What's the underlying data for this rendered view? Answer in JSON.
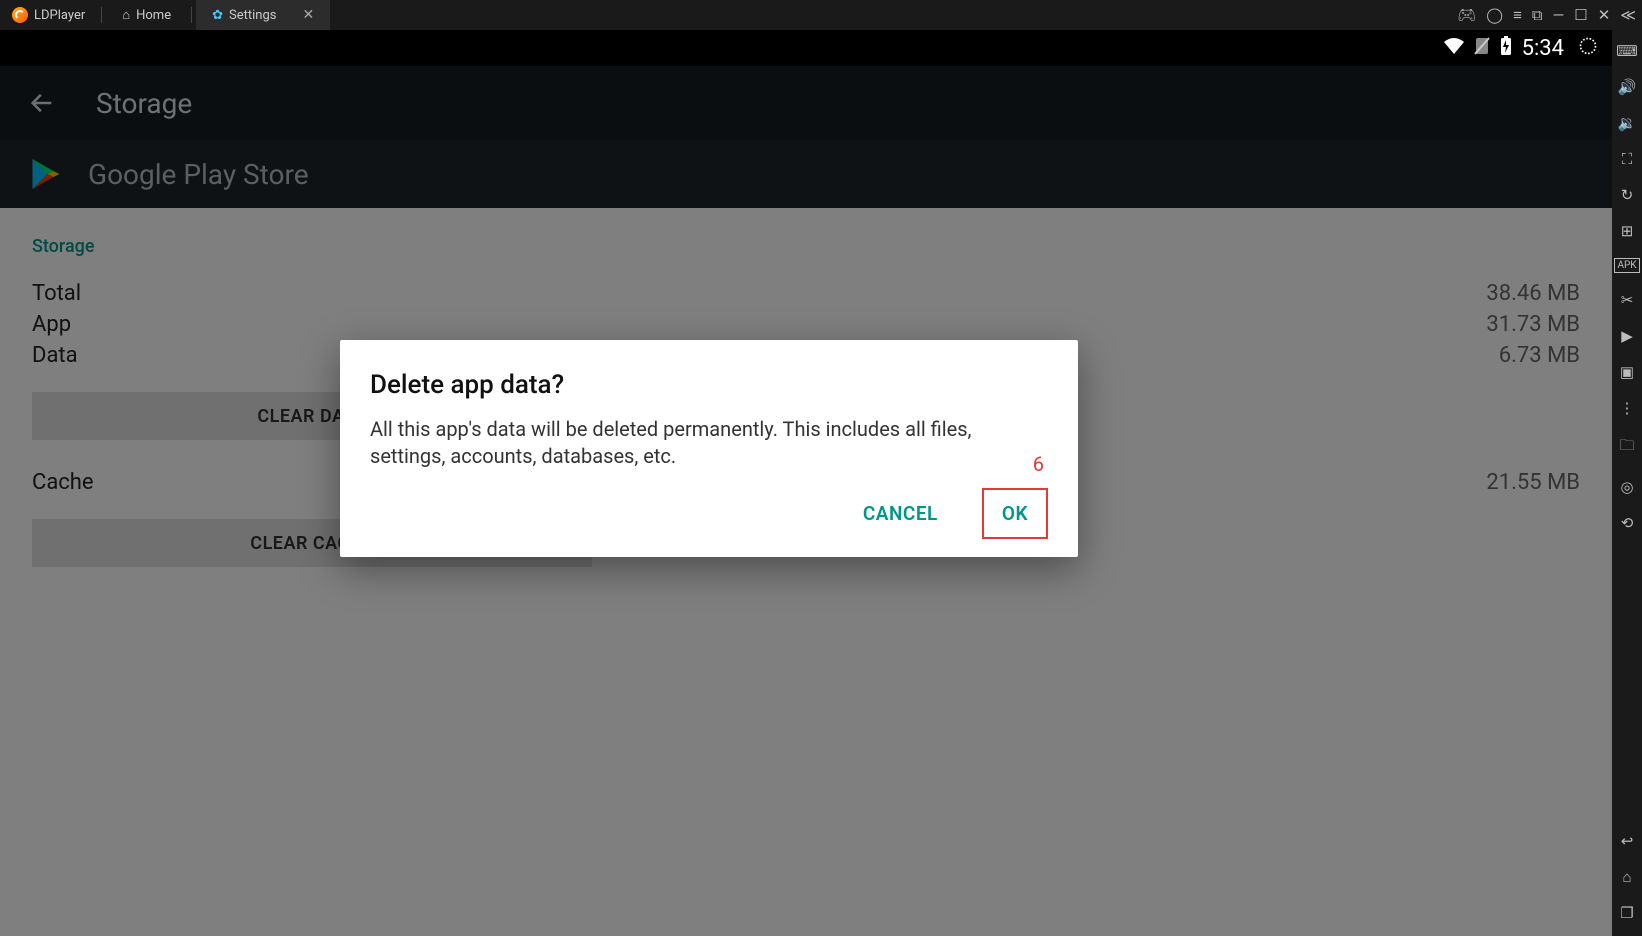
{
  "titlebar": {
    "app_name": "LDPlayer",
    "home_tab": "Home",
    "settings_tab": "Settings"
  },
  "android_status": {
    "clock": "5:34"
  },
  "settings": {
    "page_title": "Storage",
    "app_name": "Google Play Store",
    "section_label": "Storage",
    "rows": {
      "total_label": "Total",
      "total_value": "38.46 MB",
      "app_label": "App",
      "app_value": "31.73 MB",
      "data_label": "Data",
      "data_value": "6.73 MB",
      "cache_label": "Cache",
      "cache_value": "21.55 MB"
    },
    "clear_data_btn": "CLEAR DATA",
    "clear_cache_btn": "CLEAR CACHE"
  },
  "dialog": {
    "title": "Delete app data?",
    "body": "All this app's data will be deleted permanently. This includes all files, settings, accounts, databases, etc.",
    "cancel": "CANCEL",
    "ok": "OK",
    "annotation": "6"
  }
}
